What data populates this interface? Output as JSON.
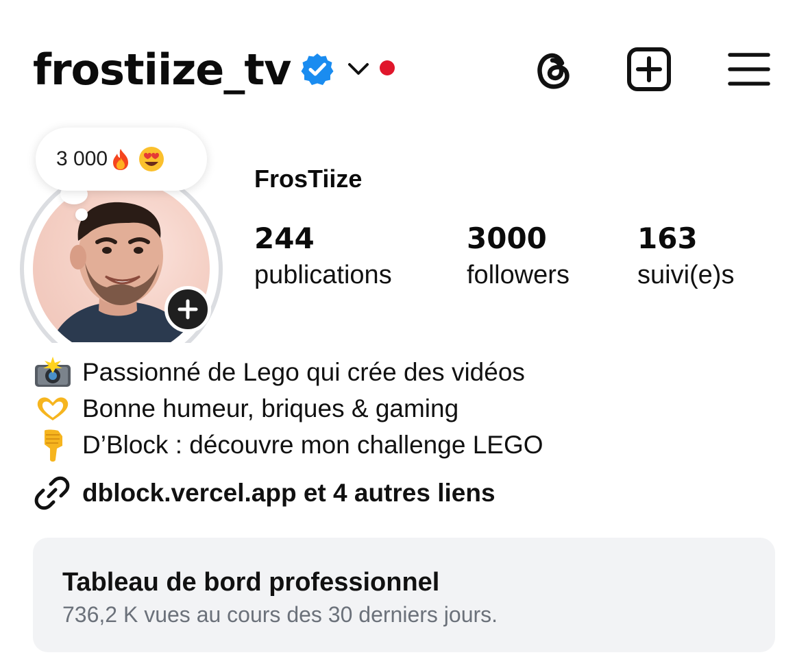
{
  "header": {
    "username": "frostiize_tv",
    "verified": true,
    "accent_verified": "#1a8cf0",
    "notification_dot_color": "#e0162b",
    "icons": [
      "verified-badge-icon",
      "chevron-down-icon",
      "threads-icon",
      "create-post-icon",
      "menu-icon"
    ]
  },
  "note": {
    "text": "3 000",
    "emojis": [
      "fire-emoji",
      "heart-eyes-emoji"
    ]
  },
  "profile": {
    "display_name": "FrosTiize",
    "stats": [
      {
        "value": "244",
        "label": "publications"
      },
      {
        "value": "3000",
        "label": "followers"
      },
      {
        "value": "163",
        "label": "suivi(e)s"
      }
    ]
  },
  "bio": {
    "lines": [
      {
        "emoji": "camera-flash-emoji",
        "text": "Passionné de Lego qui crée des vidéos"
      },
      {
        "emoji": "heart-hands-emoji",
        "text": "Bonne humeur, briques & gaming"
      },
      {
        "emoji": "pointing-down-emoji",
        "text": "D’Block : découvre mon challenge LEGO"
      }
    ],
    "link_text": "dblock.vercel.app et 4 autres liens"
  },
  "dashboard": {
    "title": "Tableau de bord professionnel",
    "subtitle": "736,2 K vues au cours des 30 derniers jours."
  }
}
